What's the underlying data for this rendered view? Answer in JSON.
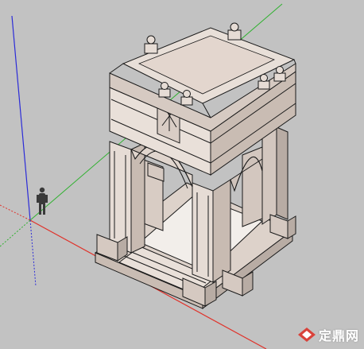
{
  "app": {
    "view": "3d-model-viewport"
  },
  "watermark": {
    "text": "定鼎网",
    "logo_color": "#d9423a"
  },
  "colors": {
    "background": "#c2c2c2",
    "axis_red": "#e0322a",
    "axis_green": "#2fb12f",
    "axis_blue": "#2b2bd8",
    "stone": "#e6dcd5",
    "stone_shadow": "#b8aca4",
    "line": "#1a1a1a"
  },
  "icons": {
    "scale_figure": "person-figure-icon",
    "watermark_logo": "diamond-logo-icon"
  }
}
